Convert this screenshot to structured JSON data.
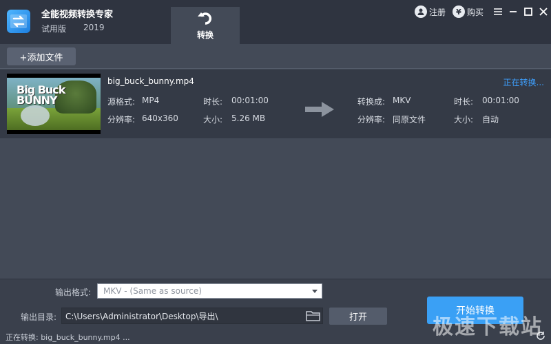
{
  "app": {
    "name": "全能视频转换专家",
    "edition": "试用版",
    "year": "2019"
  },
  "tabs": [
    {
      "label": "转换",
      "icon": "convert-arrow-icon",
      "active": true
    }
  ],
  "top_actions": {
    "register_label": "注册",
    "register_icon": "user-icon",
    "buy_label": "购买",
    "buy_icon": "yen-icon"
  },
  "window_controls": [
    "menu-icon",
    "minimize-icon",
    "maximize-icon",
    "close-icon"
  ],
  "toolbar": {
    "add_file_label": "+添加文件"
  },
  "files": [
    {
      "thumbnail_text": "Big Buck BUNNY",
      "name": "big_buck_bunny.mp4",
      "status": "正在转换...",
      "source": {
        "format_label": "源格式:",
        "format_value": "MP4",
        "duration_label": "时长:",
        "duration_value": "00:01:00",
        "resolution_label": "分辨率:",
        "resolution_value": "640x360",
        "size_label": "大小:",
        "size_value": "5.26 MB"
      },
      "target": {
        "format_label": "转换成:",
        "format_value": "MKV",
        "duration_label": "时长:",
        "duration_value": "00:01:00",
        "resolution_label": "分辨率:",
        "resolution_value": "同原文件",
        "size_label": "大小:",
        "size_value": "自动"
      }
    }
  ],
  "output": {
    "format_label": "输出格式:",
    "format_value": "MKV - (Same as source)",
    "dir_label": "输出目录:",
    "dir_value": "C:\\Users\\Administrator\\Desktop\\导出\\",
    "open_label": "打开",
    "start_label": "开始转换"
  },
  "status_bar": {
    "text": "正在转换: big_buck_bunny.mp4 ..."
  },
  "watermark": "极速下载站",
  "colors": {
    "accent": "#3aa0f5",
    "link": "#3ea0ff",
    "titlebar": "#2f3440",
    "panel": "#434a57"
  }
}
